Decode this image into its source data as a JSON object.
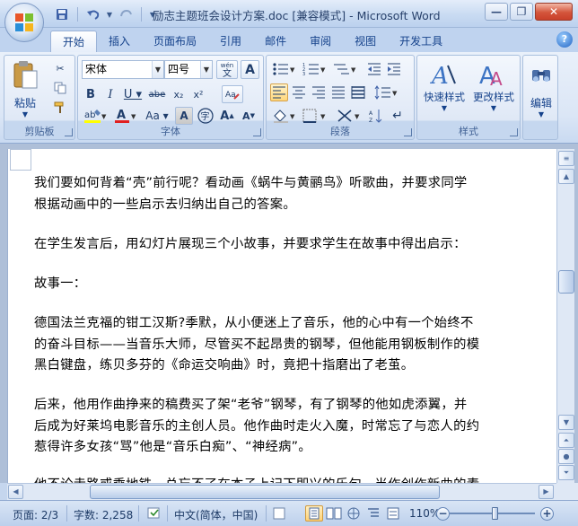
{
  "window": {
    "title": "励志主题班会设计方案.doc [兼容模式] - Microsoft Word"
  },
  "quick_access": {
    "save_icon": "save-icon",
    "undo_icon": "undo-icon",
    "redo_icon": "redo-icon"
  },
  "tabs": [
    {
      "label": "开始",
      "active": true
    },
    {
      "label": "插入"
    },
    {
      "label": "页面布局"
    },
    {
      "label": "引用"
    },
    {
      "label": "邮件"
    },
    {
      "label": "审阅"
    },
    {
      "label": "视图"
    },
    {
      "label": "开发工具"
    }
  ],
  "ribbon": {
    "clipboard": {
      "label": "剪贴板",
      "paste_label": "粘贴"
    },
    "font": {
      "label": "字体",
      "font_name": "宋体",
      "font_size": "四号",
      "wen_label": "wén"
    },
    "paragraph": {
      "label": "段落"
    },
    "styles": {
      "label": "样式",
      "quick_styles": "快速样式",
      "change_styles": "更改样式"
    },
    "editing": {
      "label": "编辑"
    }
  },
  "document": {
    "paragraphs": [
      "我们要如何背着“壳”前行呢？看动画《蜗牛与黄鹂鸟》听歌曲，并要求同学",
      "根据动画中的一些启示去归纳出自己的答案。",
      "在学生发言后，用幻灯片展现三个小故事，并要求学生在故事中得出启示：",
      "故事一：",
      "德国法兰克福的钳工汉斯?季默，从小便迷上了音乐，他的心中有一个始终不",
      "的奋斗目标——当音乐大师，尽管买不起昂贵的钢琴，但他能用钢板制作的模",
      "黑白键盘，练贝多芬的《命运交响曲》时，竟把十指磨出了老茧。",
      "后来，他用作曲挣来的稿费买了架“老爷”钢琴，有了钢琴的他如虎添翼，并",
      "后成为好莱坞电影音乐的主创人员。他作曲时走火入魔，时常忘了与恋人的约",
      "惹得许多女孩“骂”他是“音乐白痴”、“神经病”。",
      "他不论走路或乘地铁，总忘不了在本子上记下即兴的乐句。当作创作新曲的素"
    ]
  },
  "status": {
    "page": "页面: 2/3",
    "words": "字数: 2,258",
    "language": "中文(简体，中国)",
    "zoom": "110%"
  }
}
